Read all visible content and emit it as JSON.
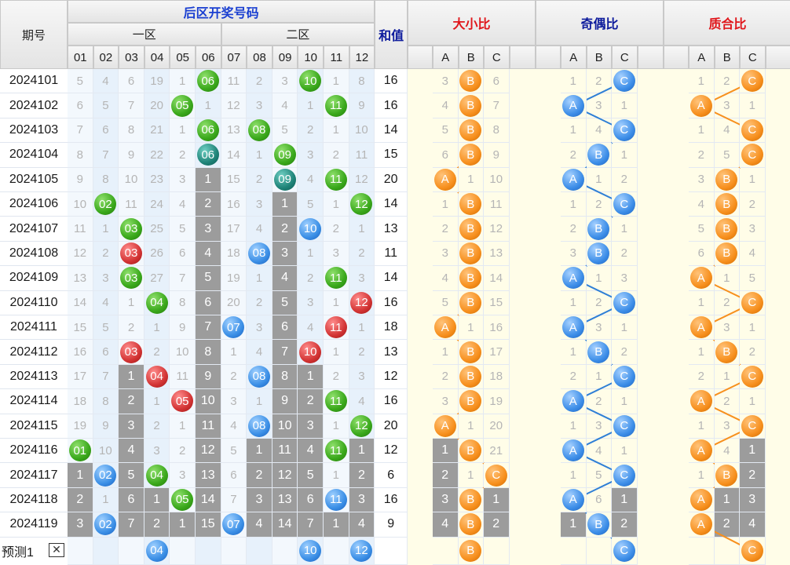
{
  "headers": {
    "period": "期号",
    "back_area": "后区开奖号码",
    "zone1": "一区",
    "zone2": "二区",
    "sum": "和值",
    "size_ratio": "大小比",
    "odd_even": "奇偶比",
    "prime_ratio": "质合比",
    "abc": [
      "A",
      "B",
      "C"
    ]
  },
  "numbers": [
    "01",
    "02",
    "03",
    "04",
    "05",
    "06",
    "07",
    "08",
    "09",
    "10",
    "11",
    "12"
  ],
  "rows": [
    {
      "period": "2024101",
      "nums": [
        "5",
        "4",
        "6",
        "19",
        "1",
        "06",
        "11",
        "2",
        "3",
        "10",
        "1",
        "8"
      ],
      "hits": {
        "5": "green",
        "9": "green"
      },
      "sum": "16",
      "size": [
        "3",
        "B",
        "6"
      ],
      "sizeHit": 1,
      "oe": [
        "1",
        "2",
        "C"
      ],
      "oeHit": 2,
      "pc": [
        "1",
        "2",
        "C"
      ],
      "pcHit": 2
    },
    {
      "period": "2024102",
      "nums": [
        "6",
        "5",
        "7",
        "20",
        "05",
        "1",
        "12",
        "3",
        "4",
        "1",
        "11",
        "9"
      ],
      "hits": {
        "4": "green",
        "10": "green"
      },
      "sum": "16",
      "size": [
        "4",
        "B",
        "7"
      ],
      "sizeHit": 1,
      "oe": [
        "A",
        "3",
        "1"
      ],
      "oeHit": 0,
      "pc": [
        "A",
        "3",
        "1"
      ],
      "pcHit": 0
    },
    {
      "period": "2024103",
      "nums": [
        "7",
        "6",
        "8",
        "21",
        "1",
        "06",
        "13",
        "08",
        "5",
        "2",
        "1",
        "10"
      ],
      "hits": {
        "5": "green",
        "7": "green"
      },
      "sum": "14",
      "size": [
        "5",
        "B",
        "8"
      ],
      "sizeHit": 1,
      "oe": [
        "1",
        "4",
        "C"
      ],
      "oeHit": 2,
      "pc": [
        "1",
        "4",
        "C"
      ],
      "pcHit": 2
    },
    {
      "period": "2024104",
      "nums": [
        "8",
        "7",
        "9",
        "22",
        "2",
        "06",
        "14",
        "1",
        "09",
        "3",
        "2",
        "11"
      ],
      "hits": {
        "5": "teal",
        "8": "green"
      },
      "sum": "15",
      "size": [
        "6",
        "B",
        "9"
      ],
      "sizeHit": 1,
      "oe": [
        "2",
        "B",
        "1"
      ],
      "oeHit": 1,
      "pc": [
        "2",
        "5",
        "C"
      ],
      "pcHit": 2
    },
    {
      "period": "2024105",
      "nums": [
        "9",
        "8",
        "10",
        "23",
        "3",
        "1",
        "15",
        "2",
        "09",
        "4",
        "11",
        "12"
      ],
      "hits": {
        "8": "teal",
        "10": "green"
      },
      "gray": [
        5
      ],
      "sum": "20",
      "size": [
        "A",
        "1",
        "10"
      ],
      "sizeHit": 0,
      "oe": [
        "A",
        "1",
        "2"
      ],
      "oeHit": 0,
      "pc": [
        "3",
        "B",
        "1"
      ],
      "pcHit": 1
    },
    {
      "period": "2024106",
      "nums": [
        "10",
        "02",
        "11",
        "24",
        "4",
        "2",
        "16",
        "3",
        "1",
        "5",
        "1",
        "12"
      ],
      "hits": {
        "1": "green",
        "11": "green"
      },
      "gray": [
        5,
        8
      ],
      "sum": "14",
      "size": [
        "1",
        "B",
        "11"
      ],
      "sizeHit": 1,
      "oe": [
        "1",
        "2",
        "C"
      ],
      "oeHit": 2,
      "pc": [
        "4",
        "B",
        "2"
      ],
      "pcHit": 1
    },
    {
      "period": "2024107",
      "nums": [
        "11",
        "1",
        "03",
        "25",
        "5",
        "3",
        "17",
        "4",
        "2",
        "10",
        "2",
        "1"
      ],
      "hits": {
        "2": "green",
        "9": "blue"
      },
      "gray": [
        5,
        8
      ],
      "sum": "13",
      "size": [
        "2",
        "B",
        "12"
      ],
      "sizeHit": 1,
      "oe": [
        "2",
        "B",
        "1"
      ],
      "oeHit": 1,
      "pc": [
        "5",
        "B",
        "3"
      ],
      "pcHit": 1
    },
    {
      "period": "2024108",
      "nums": [
        "12",
        "2",
        "03",
        "26",
        "6",
        "4",
        "18",
        "08",
        "3",
        "1",
        "3",
        "2"
      ],
      "hits": {
        "2": "red",
        "7": "blue"
      },
      "gray": [
        5,
        8
      ],
      "sum": "11",
      "size": [
        "3",
        "B",
        "13"
      ],
      "sizeHit": 1,
      "oe": [
        "3",
        "B",
        "2"
      ],
      "oeHit": 1,
      "pc": [
        "6",
        "B",
        "4"
      ],
      "pcHit": 1
    },
    {
      "period": "2024109",
      "nums": [
        "13",
        "3",
        "03",
        "27",
        "7",
        "5",
        "19",
        "1",
        "4",
        "2",
        "11",
        "3"
      ],
      "hits": {
        "2": "green",
        "10": "green"
      },
      "gray": [
        5,
        8
      ],
      "sum": "14",
      "size": [
        "4",
        "B",
        "14"
      ],
      "sizeHit": 1,
      "oe": [
        "A",
        "1",
        "3"
      ],
      "oeHit": 0,
      "pc": [
        "A",
        "1",
        "5"
      ],
      "pcHit": 0
    },
    {
      "period": "2024110",
      "nums": [
        "14",
        "4",
        "1",
        "04",
        "8",
        "6",
        "20",
        "2",
        "5",
        "3",
        "1",
        "12"
      ],
      "hits": {
        "3": "green",
        "11": "red"
      },
      "gray": [
        5,
        8
      ],
      "sum": "16",
      "size": [
        "5",
        "B",
        "15"
      ],
      "sizeHit": 1,
      "oe": [
        "1",
        "2",
        "C"
      ],
      "oeHit": 2,
      "pc": [
        "1",
        "2",
        "C"
      ],
      "pcHit": 2
    },
    {
      "period": "2024111",
      "nums": [
        "15",
        "5",
        "2",
        "1",
        "9",
        "7",
        "07",
        "3",
        "6",
        "4",
        "11",
        "1"
      ],
      "hits": {
        "6": "blue",
        "10": "red"
      },
      "gray": [
        5,
        8
      ],
      "sum": "18",
      "size": [
        "A",
        "1",
        "16"
      ],
      "sizeHit": 0,
      "oe": [
        "A",
        "3",
        "1"
      ],
      "oeHit": 0,
      "pc": [
        "A",
        "3",
        "1"
      ],
      "pcHit": 0
    },
    {
      "period": "2024112",
      "nums": [
        "16",
        "6",
        "03",
        "2",
        "10",
        "8",
        "1",
        "4",
        "7",
        "10",
        "1",
        "2"
      ],
      "hits": {
        "2": "red",
        "9": "red"
      },
      "gray": [
        5,
        8
      ],
      "sum": "13",
      "size": [
        "1",
        "B",
        "17"
      ],
      "sizeHit": 1,
      "oe": [
        "1",
        "B",
        "2"
      ],
      "oeHit": 1,
      "pc": [
        "1",
        "B",
        "2"
      ],
      "pcHit": 1
    },
    {
      "period": "2024113",
      "nums": [
        "17",
        "7",
        "1",
        "04",
        "11",
        "9",
        "2",
        "08",
        "8",
        "1",
        "2",
        "3"
      ],
      "hits": {
        "3": "red",
        "7": "blue"
      },
      "gray": [
        2,
        5,
        8,
        9
      ],
      "sum": "12",
      "size": [
        "2",
        "B",
        "18"
      ],
      "sizeHit": 1,
      "oe": [
        "2",
        "1",
        "C"
      ],
      "oeHit": 2,
      "pc": [
        "2",
        "1",
        "C"
      ],
      "pcHit": 2
    },
    {
      "period": "2024114",
      "nums": [
        "18",
        "8",
        "2",
        "1",
        "05",
        "10",
        "3",
        "1",
        "9",
        "2",
        "11",
        "4"
      ],
      "hits": {
        "4": "red",
        "10": "green"
      },
      "gray": [
        2,
        5,
        8,
        9
      ],
      "sum": "16",
      "size": [
        "3",
        "B",
        "19"
      ],
      "sizeHit": 1,
      "oe": [
        "A",
        "2",
        "1"
      ],
      "oeHit": 0,
      "pc": [
        "A",
        "2",
        "1"
      ],
      "pcHit": 0
    },
    {
      "period": "2024115",
      "nums": [
        "19",
        "9",
        "3",
        "2",
        "1",
        "11",
        "4",
        "08",
        "10",
        "3",
        "1",
        "12"
      ],
      "hits": {
        "7": "blue",
        "11": "green"
      },
      "gray": [
        2,
        5,
        8,
        9
      ],
      "sum": "20",
      "size": [
        "A",
        "1",
        "20"
      ],
      "sizeHit": 0,
      "oe": [
        "1",
        "3",
        "C"
      ],
      "oeHit": 2,
      "pc": [
        "1",
        "3",
        "C"
      ],
      "pcHit": 2
    },
    {
      "period": "2024116",
      "nums": [
        "01",
        "10",
        "4",
        "3",
        "2",
        "12",
        "5",
        "1",
        "11",
        "4",
        "11",
        "1"
      ],
      "hits": {
        "0": "green",
        "10": "green"
      },
      "gray": [
        2,
        5,
        7,
        8,
        9,
        11
      ],
      "sum": "12",
      "size": [
        "1",
        "B",
        "21"
      ],
      "sizeHit": 1,
      "sizeGray": [
        0
      ],
      "oe": [
        "A",
        "4",
        "1"
      ],
      "oeHit": 0,
      "pc": [
        "A",
        "4",
        "1"
      ],
      "pcHit": 0,
      "pcGray": [
        2
      ]
    },
    {
      "period": "2024117",
      "nums": [
        "1",
        "02",
        "5",
        "04",
        "3",
        "13",
        "6",
        "2",
        "12",
        "5",
        "1",
        "2"
      ],
      "hits": {
        "1": "blue",
        "3": "green"
      },
      "gray": [
        0,
        2,
        5,
        7,
        8,
        9,
        11
      ],
      "sum": "6",
      "size": [
        "2",
        "1",
        "C"
      ],
      "sizeHit": 2,
      "sizeGray": [
        0
      ],
      "oe": [
        "1",
        "5",
        "C"
      ],
      "oeHit": 2,
      "pc": [
        "1",
        "B",
        "2"
      ],
      "pcHit": 1,
      "pcGray": [
        2
      ]
    },
    {
      "period": "2024118",
      "nums": [
        "2",
        "1",
        "6",
        "1",
        "05",
        "14",
        "7",
        "3",
        "13",
        "6",
        "11",
        "3"
      ],
      "hits": {
        "4": "green",
        "10": "blue"
      },
      "gray": [
        0,
        2,
        3,
        5,
        7,
        8,
        9,
        11
      ],
      "sum": "16",
      "size": [
        "3",
        "B",
        "1"
      ],
      "sizeHit": 1,
      "sizeGray": [
        0,
        2
      ],
      "oe": [
        "A",
        "6",
        "1"
      ],
      "oeHit": 0,
      "oeGray": [
        2
      ],
      "pc": [
        "A",
        "1",
        "3"
      ],
      "pcHit": 0,
      "pcGray": [
        1,
        2
      ]
    },
    {
      "period": "2024119",
      "nums": [
        "3",
        "02",
        "7",
        "2",
        "1",
        "15",
        "07",
        "4",
        "14",
        "7",
        "1",
        "4"
      ],
      "hits": {
        "1": "blue",
        "6": "blue"
      },
      "gray": [
        0,
        2,
        3,
        4,
        5,
        7,
        8,
        9,
        10,
        11
      ],
      "sum": "9",
      "size": [
        "4",
        "B",
        "2"
      ],
      "sizeHit": 1,
      "sizeGray": [
        0,
        2
      ],
      "oe": [
        "1",
        "B",
        "2"
      ],
      "oeHit": 1,
      "oeGray": [
        0,
        2
      ],
      "pc": [
        "A",
        "2",
        "4"
      ],
      "pcHit": 0,
      "pcGray": [
        1,
        2
      ]
    }
  ],
  "prediction": {
    "label": "预测1",
    "close": "✕",
    "balls": {
      "3": "04",
      "9": "10",
      "11": "12"
    },
    "size": "B",
    "oe": "C",
    "pc": "C"
  }
}
